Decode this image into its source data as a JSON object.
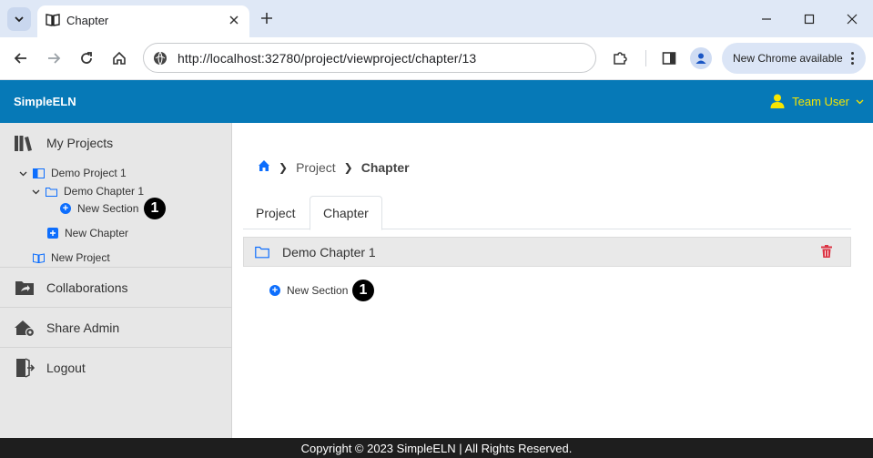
{
  "browser": {
    "tab_title": "Chapter",
    "url": "http://localhost:32780/project/viewproject/chapter/13",
    "update_label": "New Chrome available"
  },
  "app": {
    "brand": "SimpleELN",
    "user_name": "Team User",
    "header_color": "#0679b7",
    "user_color": "#f7e600"
  },
  "sidebar": {
    "my_projects": "My Projects",
    "tree": {
      "project": "Demo Project 1",
      "chapter": "Demo Chapter 1",
      "new_section": "New Section",
      "new_chapter": "New Chapter",
      "new_project": "New Project"
    },
    "collaborations": "Collaborations",
    "share_admin": "Share Admin",
    "logout": "Logout"
  },
  "markers": {
    "sidebar": "1",
    "main": "1"
  },
  "main": {
    "breadcrumb": {
      "project": "Project",
      "current": "Chapter"
    },
    "tabs": [
      {
        "label": "Project",
        "active": false
      },
      {
        "label": "Chapter",
        "active": true
      }
    ],
    "chapter_title": "Demo Chapter 1",
    "new_section": "New Section"
  },
  "footer": {
    "text": "Copyright © 2023 SimpleELN | All Rights Reserved."
  }
}
